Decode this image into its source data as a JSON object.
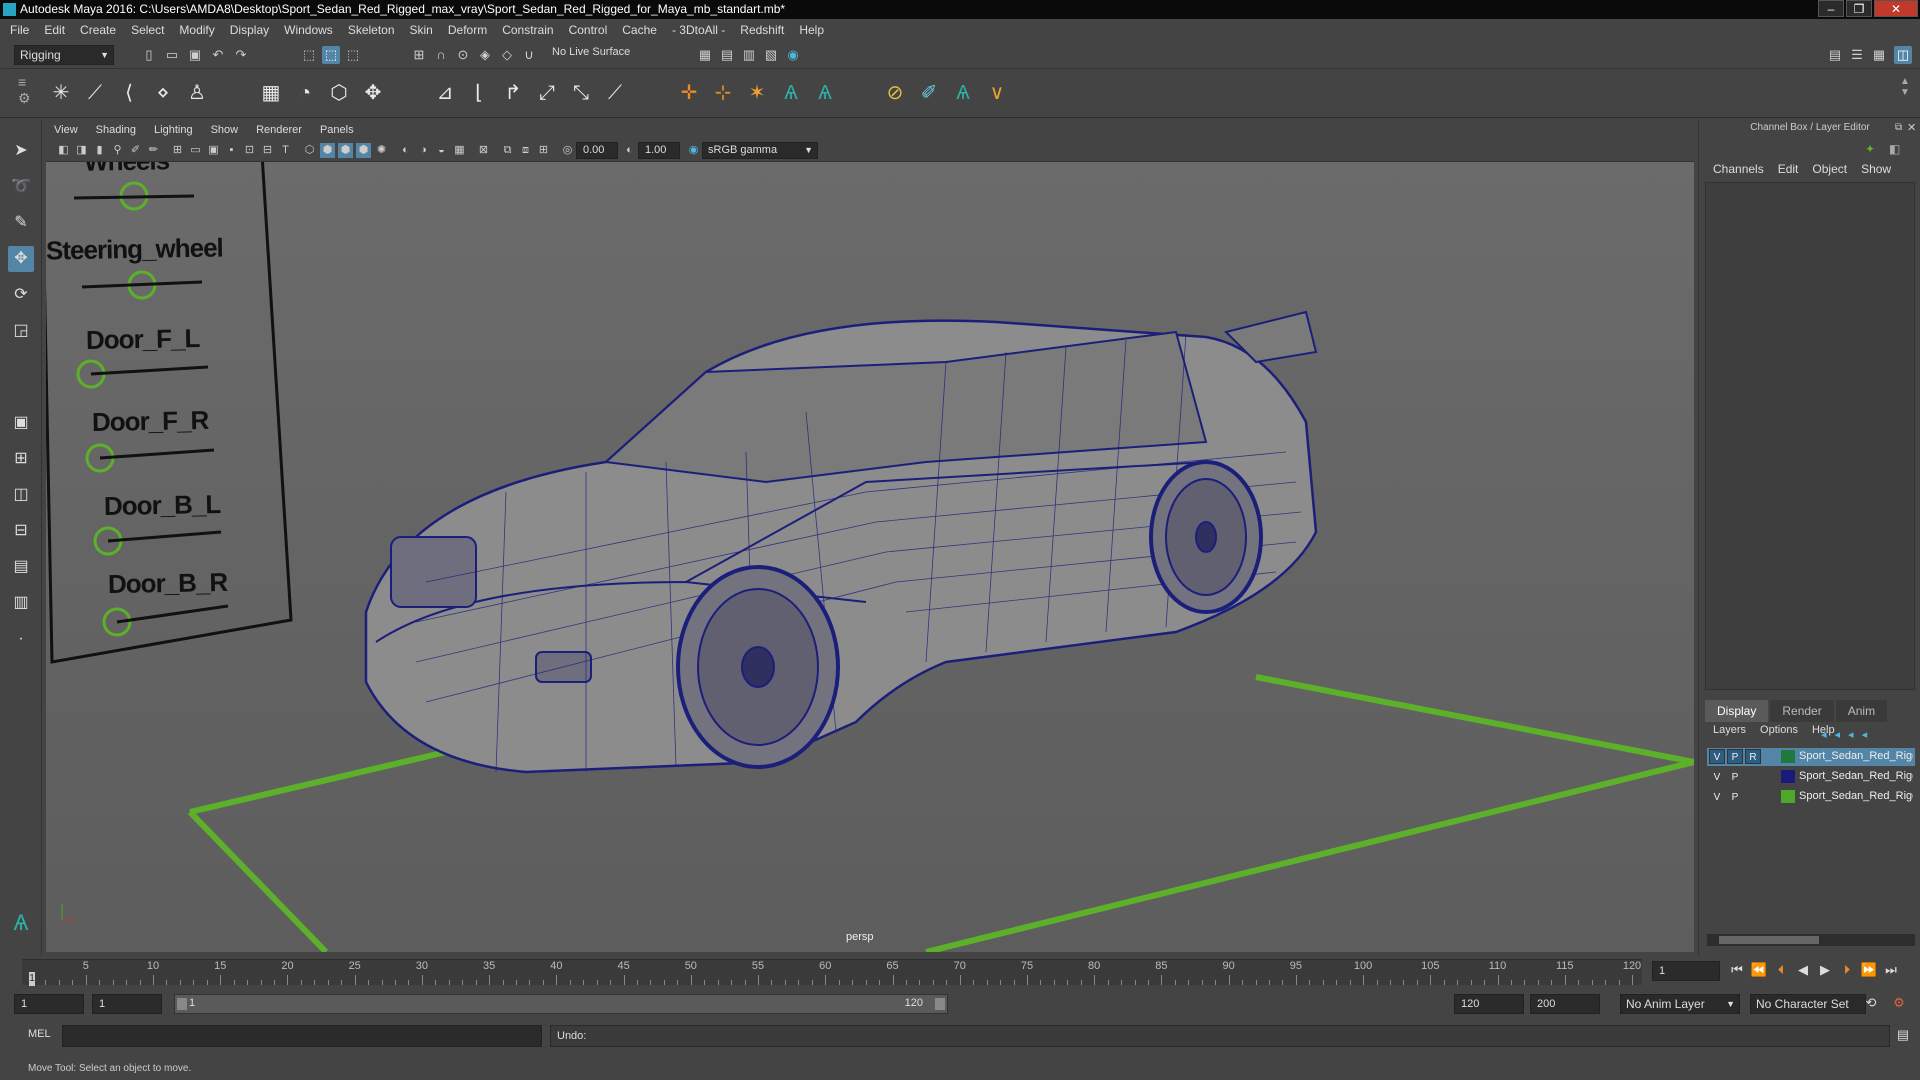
{
  "window": {
    "title": "Autodesk Maya 2016: C:\\Users\\AMDA8\\Desktop\\Sport_Sedan_Red_Rigged_max_vray\\Sport_Sedan_Red_Rigged_for_Maya_mb_standart.mb*",
    "controls": [
      "–",
      "❐",
      "✕"
    ]
  },
  "menubar": [
    "File",
    "Edit",
    "Create",
    "Select",
    "Modify",
    "Display",
    "Windows",
    "Skeleton",
    "Skin",
    "Deform",
    "Constrain",
    "Control",
    "Cache",
    "- 3DtoAll -",
    "Redshift",
    "Help"
  ],
  "statusline": {
    "menuset": "Rigging",
    "live_surface": "No Live Surface"
  },
  "panel": {
    "menu": [
      "View",
      "Shading",
      "Lighting",
      "Show",
      "Renderer",
      "Panels"
    ],
    "exposure": "0.00",
    "gamma": "1.00",
    "colorspace": "sRGB gamma",
    "camera_label": "persp"
  },
  "rig_controls": [
    "Wheels",
    "Steering_wheel",
    "Door_F_L",
    "Door_F_R",
    "Door_B_L",
    "Door_B_R"
  ],
  "channel_box": {
    "title": "Channel Box / Layer Editor",
    "menu": [
      "Channels",
      "Edit",
      "Object",
      "Show"
    ],
    "layer_tabs": [
      "Display",
      "Render",
      "Anim"
    ],
    "layer_menu": [
      "Layers",
      "Options",
      "Help"
    ],
    "layers": [
      {
        "v": "V",
        "p": "P",
        "r": "R",
        "color": "#1e7a3a",
        "name": "Sport_Sedan_Red_Rigged_Controllers",
        "selected": true
      },
      {
        "v": "V",
        "p": "P",
        "r": "",
        "color": "#1a1a7a",
        "name": "Sport_Sedan_Red_Rigged_Geometry",
        "selected": false
      },
      {
        "v": "V",
        "p": "P",
        "r": "",
        "color": "#4fa82a",
        "name": "Sport_Sedan_Red_Rigged_Helpers",
        "selected": false
      }
    ]
  },
  "timeline": {
    "ticks": [
      "5",
      "10",
      "15",
      "20",
      "25",
      "30",
      "35",
      "40",
      "45",
      "50",
      "55",
      "60",
      "65",
      "70",
      "75",
      "80",
      "85",
      "90",
      "95",
      "100",
      "105",
      "110",
      "115",
      "120"
    ],
    "start_marker": "1",
    "current_frame": "1"
  },
  "range": {
    "start": "1",
    "playback_start": "1",
    "slider_start": "1",
    "slider_end": "120",
    "playback_end": "120",
    "end": "200",
    "anim_layer": "No Anim Layer",
    "character_set": "No Character Set"
  },
  "command": {
    "lang": "MEL",
    "result": "Undo:"
  },
  "helpline": "Move Tool: Select an object to move."
}
